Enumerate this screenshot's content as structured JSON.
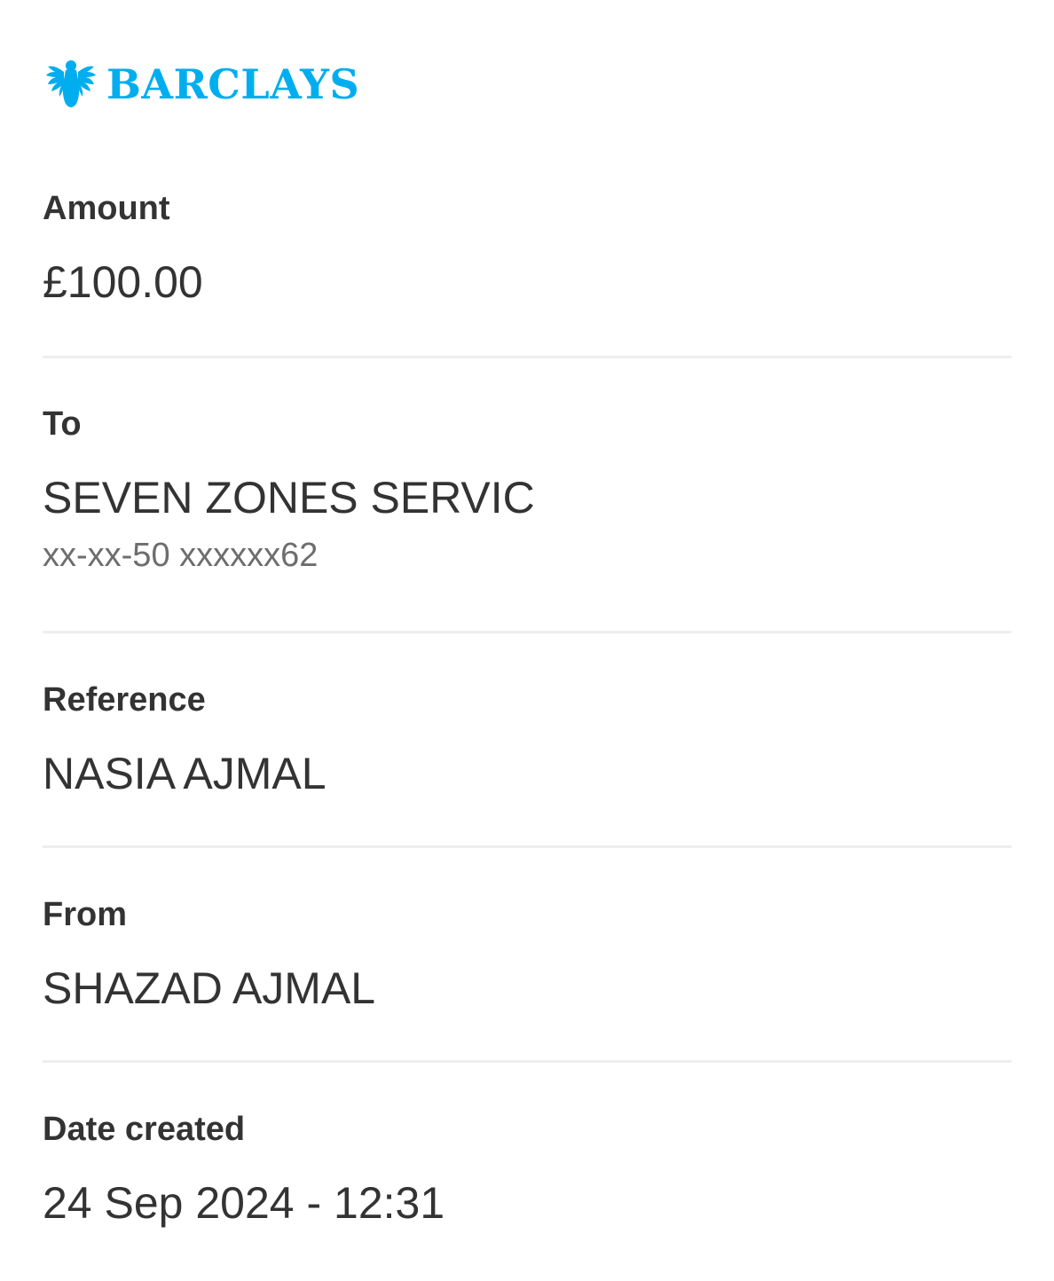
{
  "brand": {
    "name": "BARCLAYS",
    "color": "#00aeef",
    "logo_icon": "eagle-icon"
  },
  "details": {
    "amount": {
      "label": "Amount",
      "value": "£100.00"
    },
    "to": {
      "label": "To",
      "value": "SEVEN ZONES SERVIC",
      "account": "xx-xx-50 xxxxxx62"
    },
    "reference": {
      "label": "Reference",
      "value": "NASIA AJMAL"
    },
    "from": {
      "label": "From",
      "value": "SHAZAD AJMAL"
    },
    "date_created": {
      "label": "Date created",
      "value": "24 Sep 2024 - 12:31"
    }
  },
  "colors": {
    "text": "#333333",
    "subtext": "#6d6d6d",
    "divider": "#eeeeee"
  }
}
